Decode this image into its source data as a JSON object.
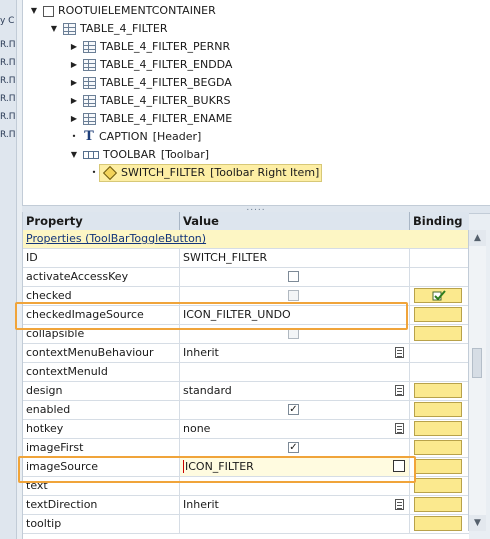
{
  "left_strip": {
    "items": [
      "y C",
      "R.П",
      "R.П",
      "R.П",
      "R.П",
      "R.П",
      "R.П"
    ]
  },
  "tree": {
    "nodes": [
      {
        "label": "ROOTUIELEMENTCONTAINER",
        "icon": "container-icon"
      },
      {
        "label": "TABLE_4_FILTER",
        "icon": "table-icon"
      },
      {
        "label": "TABLE_4_FILTER_PERNR",
        "icon": "table-icon"
      },
      {
        "label": "TABLE_4_FILTER_ENDDA",
        "icon": "table-icon"
      },
      {
        "label": "TABLE_4_FILTER_BEGDA",
        "icon": "table-icon"
      },
      {
        "label": "TABLE_4_FILTER_BUKRS",
        "icon": "table-icon"
      },
      {
        "label": "TABLE_4_FILTER_ENAME",
        "icon": "table-icon"
      },
      {
        "label": "CAPTION",
        "suffix": "[Header]",
        "icon": "caption-icon"
      },
      {
        "label": "TOOLBAR",
        "suffix": "[Toolbar]",
        "icon": "toolbar-icon"
      },
      {
        "label": "SWITCH_FILTER",
        "suffix": "[Toolbar Right Item]",
        "icon": "toggle-button-icon"
      }
    ],
    "splitter_grip": "....."
  },
  "grid": {
    "headers": {
      "property": "Property",
      "value": "Value",
      "binding": "Binding"
    },
    "group_label": "Properties (ToolBarToggleButton)",
    "rows": [
      {
        "property": "ID",
        "value": "SWITCH_FILTER"
      },
      {
        "property": "activateAccessKey",
        "value": ""
      },
      {
        "property": "checked",
        "value": ""
      },
      {
        "property": "checkedImageSource",
        "value": "ICON_FILTER_UNDO"
      },
      {
        "property": "collapsible",
        "value": ""
      },
      {
        "property": "contextMenuBehaviour",
        "value": "Inherit"
      },
      {
        "property": "contextMenuId",
        "value": ""
      },
      {
        "property": "design",
        "value": "standard"
      },
      {
        "property": "enabled",
        "value": ""
      },
      {
        "property": "hotkey",
        "value": "none"
      },
      {
        "property": "imageFirst",
        "value": ""
      },
      {
        "property": "imageSource",
        "value": "ICON_FILTER"
      },
      {
        "property": "text",
        "value": ""
      },
      {
        "property": "textDirection",
        "value": "Inherit"
      },
      {
        "property": "tooltip",
        "value": ""
      }
    ]
  },
  "checkmark": "✓",
  "colors": {
    "highlight": "#f0a43a",
    "group_bg": "#fdf6c4",
    "binding_button": "#fbe98e",
    "selection": "#fdeea4"
  }
}
